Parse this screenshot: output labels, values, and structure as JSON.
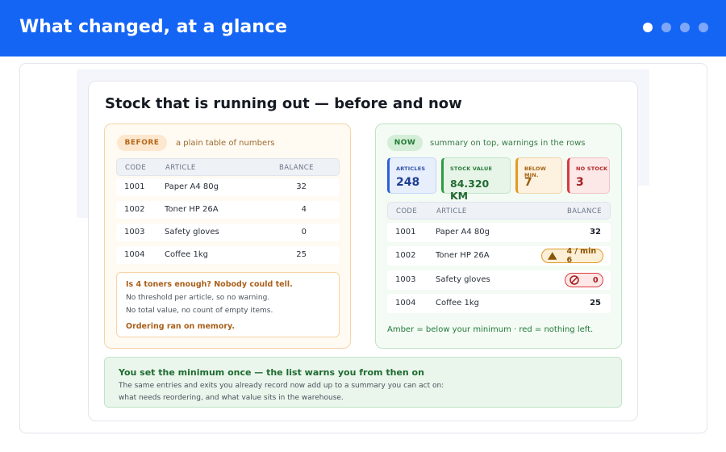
{
  "header": {
    "title": "What changed, at a glance",
    "colors": {
      "bar": "#1565f5"
    },
    "pager": {
      "total": 4,
      "current": 1
    }
  },
  "slide": {
    "title": "Stock that is running out — before and now",
    "before": {
      "tag": "BEFORE",
      "subtitle": "a plain table of numbers",
      "columns": [
        "CODE",
        "ARTICLE",
        "BALANCE"
      ],
      "rows": [
        {
          "code": "1001",
          "article": "Paper A4 80g",
          "balance": "32"
        },
        {
          "code": "1002",
          "article": "Toner HP 26A",
          "balance": "4"
        },
        {
          "code": "1003",
          "article": "Safety gloves",
          "balance": "0"
        },
        {
          "code": "1004",
          "article": "Coffee 1kg",
          "balance": "25"
        }
      ],
      "note": {
        "question": "Is 4 toners enough? Nobody could tell.",
        "line1": "No threshold per article, so no warning.",
        "line2": "No total value, no count of empty items.",
        "conclusion": "Ordering ran on memory."
      }
    },
    "now": {
      "tag": "NOW",
      "subtitle": "summary on top, warnings in the rows",
      "stats": [
        {
          "label": "ARTICLES",
          "value": "248"
        },
        {
          "label": "STOCK VALUE",
          "value": "84.320 KM"
        },
        {
          "label": "BELOW MIN.",
          "value": "7"
        },
        {
          "label": "NO STOCK",
          "value": "3"
        }
      ],
      "columns": [
        "CODE",
        "ARTICLE",
        "BALANCE"
      ],
      "rows": [
        {
          "code": "1001",
          "article": "Paper A4 80g",
          "balance": "32"
        },
        {
          "code": "1002",
          "article": "Toner HP 26A",
          "balance": "4 / min 6",
          "status": "amber",
          "icon": "warning-triangle-icon"
        },
        {
          "code": "1003",
          "article": "Safety gloves",
          "balance": "0",
          "status": "red",
          "icon": "no-entry-icon"
        },
        {
          "code": "1004",
          "article": "Coffee 1kg",
          "balance": "25"
        }
      ],
      "legend": "Amber = below your minimum · red = nothing left."
    },
    "footer": {
      "title": "You set the minimum once — the list warns you from then on",
      "line1": "The same entries and exits you already record now add up to a summary you can act on:",
      "line2": "what needs reordering, and what value sits in the warehouse."
    }
  }
}
